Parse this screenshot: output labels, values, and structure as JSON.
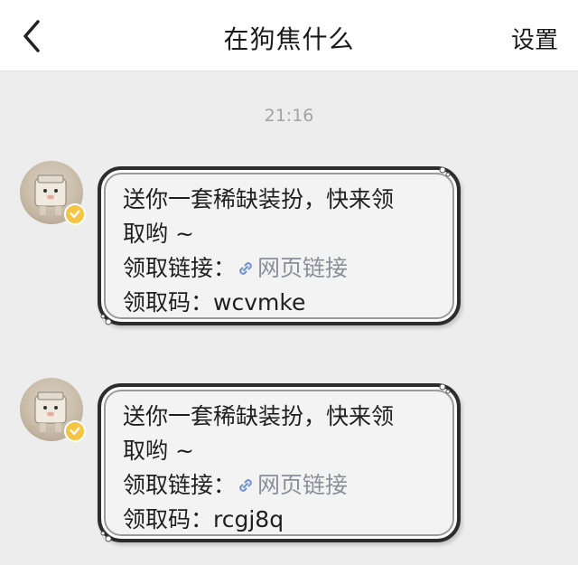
{
  "header": {
    "title": "在狗焦什么",
    "settings_label": "设置"
  },
  "timestamp": "21:16",
  "messages": [
    {
      "line1": "送你一套稀缺装扮，快来领",
      "line2": "取哟 ~",
      "link_label": "领取链接：",
      "link_text": "网页链接",
      "code_label": "领取码：",
      "code": "wcvmke"
    },
    {
      "line1": "送你一套稀缺装扮，快来领",
      "line2": "取哟 ~",
      "link_label": "领取链接：",
      "link_text": "网页链接",
      "code_label": "领取码：",
      "code": "rcgj8q"
    }
  ],
  "colors": {
    "header_bg": "#ffffff",
    "page_bg": "#ededed",
    "bubble_border": "#2c2c2c",
    "link": "#8a8f99",
    "verified_badge": "#f6c443"
  }
}
